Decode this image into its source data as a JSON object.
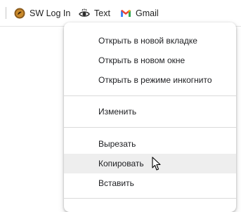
{
  "bookmarks_bar": {
    "items": [
      {
        "label": "SW Log In",
        "icon": "sw-logo-icon"
      },
      {
        "label": "Text",
        "icon": "eye-icon"
      },
      {
        "label": "Gmail",
        "icon": "gmail-icon"
      }
    ]
  },
  "context_menu": {
    "groups": [
      [
        "Открыть в новой вкладке",
        "Открыть в новом окне",
        "Открыть в режиме инкогнито"
      ],
      [
        "Изменить"
      ],
      [
        "Вырезать",
        "Копировать",
        "Вставить"
      ]
    ],
    "hovered_item": "Копировать"
  },
  "colors": {
    "hover_bg": "#eeeeee",
    "divider": "#dadada",
    "gmail_red": "#ea4335"
  }
}
